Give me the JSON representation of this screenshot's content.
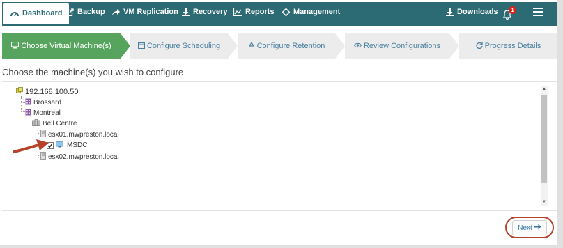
{
  "nav": {
    "items": [
      {
        "label": "Dashboard",
        "icon": "dashboard-icon"
      },
      {
        "label": "Backup",
        "icon": "external-link-icon"
      },
      {
        "label": "VM Replication",
        "icon": "share-icon"
      },
      {
        "label": "Recovery",
        "icon": "download-icon"
      },
      {
        "label": "Reports",
        "icon": "line-chart-icon"
      },
      {
        "label": "Management",
        "icon": "diamond-move-icon"
      }
    ],
    "downloads_label": "Downloads",
    "notification_count": "1"
  },
  "wizard": {
    "steps": [
      {
        "label": "Choose Virtual Machine(s)",
        "icon": "desktop-icon"
      },
      {
        "label": "Configure Scheduling",
        "icon": "calendar-icon"
      },
      {
        "label": "Configure Retention",
        "icon": "recycle-icon"
      },
      {
        "label": "Review Configurations",
        "icon": "eye-icon"
      },
      {
        "label": "Progress Details",
        "icon": "refresh-icon"
      }
    ]
  },
  "heading": "Choose the machine(s) you wish to configure",
  "tree": {
    "root": "192.168.100.50",
    "dc1": "Brossard",
    "dc2": "Montreal",
    "cluster": "Bell Centre",
    "host1": "esx01.mwpreston.local",
    "vm": "MSDC",
    "host2": "esx02.mwpreston.local"
  },
  "next_label": "Next",
  "colors": {
    "nav_bg": "#2d6b74",
    "step_active": "#56a45e",
    "annotation": "#b5432a"
  }
}
